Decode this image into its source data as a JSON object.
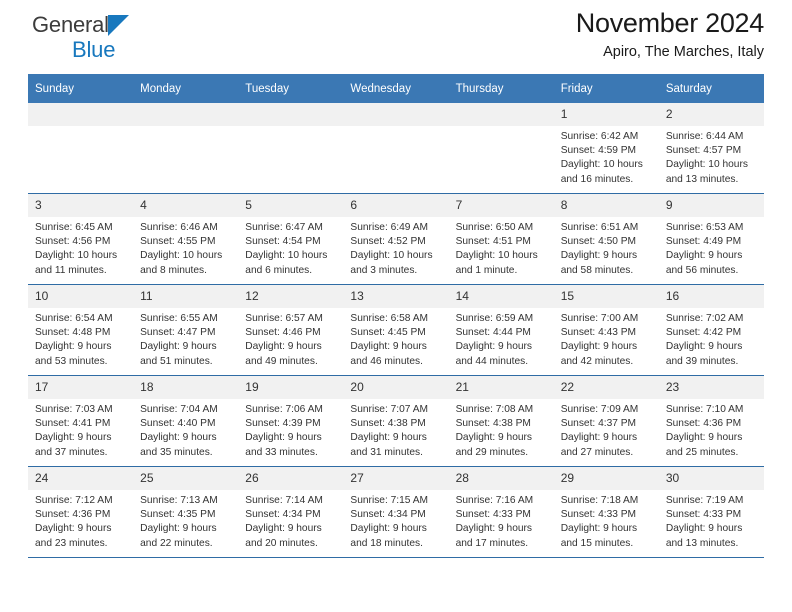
{
  "brand": {
    "word1": "General",
    "word2": "Blue",
    "triangle_color": "#1878be",
    "word1_color": "#3c3c3c",
    "word2_color": "#1878be"
  },
  "header": {
    "title": "November 2024",
    "subtitle": "Apiro, The Marches, Italy",
    "header_bg": "#3b78b4",
    "row_line_color": "#2f6ca5",
    "daynum_bg": "#f1f1f1"
  },
  "weekday_headers": [
    "Sunday",
    "Monday",
    "Tuesday",
    "Wednesday",
    "Thursday",
    "Friday",
    "Saturday"
  ],
  "weeks": [
    [
      {
        "day": "",
        "empty": true,
        "sunrise": "",
        "sunset": "",
        "daylight1": "",
        "daylight2": ""
      },
      {
        "day": "",
        "empty": true,
        "sunrise": "",
        "sunset": "",
        "daylight1": "",
        "daylight2": ""
      },
      {
        "day": "",
        "empty": true,
        "sunrise": "",
        "sunset": "",
        "daylight1": "",
        "daylight2": ""
      },
      {
        "day": "",
        "empty": true,
        "sunrise": "",
        "sunset": "",
        "daylight1": "",
        "daylight2": ""
      },
      {
        "day": "",
        "empty": true,
        "sunrise": "",
        "sunset": "",
        "daylight1": "",
        "daylight2": ""
      },
      {
        "day": "1",
        "sunrise": "Sunrise: 6:42 AM",
        "sunset": "Sunset: 4:59 PM",
        "daylight1": "Daylight: 10 hours",
        "daylight2": "and 16 minutes."
      },
      {
        "day": "2",
        "sunrise": "Sunrise: 6:44 AM",
        "sunset": "Sunset: 4:57 PM",
        "daylight1": "Daylight: 10 hours",
        "daylight2": "and 13 minutes."
      }
    ],
    [
      {
        "day": "3",
        "sunrise": "Sunrise: 6:45 AM",
        "sunset": "Sunset: 4:56 PM",
        "daylight1": "Daylight: 10 hours",
        "daylight2": "and 11 minutes."
      },
      {
        "day": "4",
        "sunrise": "Sunrise: 6:46 AM",
        "sunset": "Sunset: 4:55 PM",
        "daylight1": "Daylight: 10 hours",
        "daylight2": "and 8 minutes."
      },
      {
        "day": "5",
        "sunrise": "Sunrise: 6:47 AM",
        "sunset": "Sunset: 4:54 PM",
        "daylight1": "Daylight: 10 hours",
        "daylight2": "and 6 minutes."
      },
      {
        "day": "6",
        "sunrise": "Sunrise: 6:49 AM",
        "sunset": "Sunset: 4:52 PM",
        "daylight1": "Daylight: 10 hours",
        "daylight2": "and 3 minutes."
      },
      {
        "day": "7",
        "sunrise": "Sunrise: 6:50 AM",
        "sunset": "Sunset: 4:51 PM",
        "daylight1": "Daylight: 10 hours",
        "daylight2": "and 1 minute."
      },
      {
        "day": "8",
        "sunrise": "Sunrise: 6:51 AM",
        "sunset": "Sunset: 4:50 PM",
        "daylight1": "Daylight: 9 hours",
        "daylight2": "and 58 minutes."
      },
      {
        "day": "9",
        "sunrise": "Sunrise: 6:53 AM",
        "sunset": "Sunset: 4:49 PM",
        "daylight1": "Daylight: 9 hours",
        "daylight2": "and 56 minutes."
      }
    ],
    [
      {
        "day": "10",
        "sunrise": "Sunrise: 6:54 AM",
        "sunset": "Sunset: 4:48 PM",
        "daylight1": "Daylight: 9 hours",
        "daylight2": "and 53 minutes."
      },
      {
        "day": "11",
        "sunrise": "Sunrise: 6:55 AM",
        "sunset": "Sunset: 4:47 PM",
        "daylight1": "Daylight: 9 hours",
        "daylight2": "and 51 minutes."
      },
      {
        "day": "12",
        "sunrise": "Sunrise: 6:57 AM",
        "sunset": "Sunset: 4:46 PM",
        "daylight1": "Daylight: 9 hours",
        "daylight2": "and 49 minutes."
      },
      {
        "day": "13",
        "sunrise": "Sunrise: 6:58 AM",
        "sunset": "Sunset: 4:45 PM",
        "daylight1": "Daylight: 9 hours",
        "daylight2": "and 46 minutes."
      },
      {
        "day": "14",
        "sunrise": "Sunrise: 6:59 AM",
        "sunset": "Sunset: 4:44 PM",
        "daylight1": "Daylight: 9 hours",
        "daylight2": "and 44 minutes."
      },
      {
        "day": "15",
        "sunrise": "Sunrise: 7:00 AM",
        "sunset": "Sunset: 4:43 PM",
        "daylight1": "Daylight: 9 hours",
        "daylight2": "and 42 minutes."
      },
      {
        "day": "16",
        "sunrise": "Sunrise: 7:02 AM",
        "sunset": "Sunset: 4:42 PM",
        "daylight1": "Daylight: 9 hours",
        "daylight2": "and 39 minutes."
      }
    ],
    [
      {
        "day": "17",
        "sunrise": "Sunrise: 7:03 AM",
        "sunset": "Sunset: 4:41 PM",
        "daylight1": "Daylight: 9 hours",
        "daylight2": "and 37 minutes."
      },
      {
        "day": "18",
        "sunrise": "Sunrise: 7:04 AM",
        "sunset": "Sunset: 4:40 PM",
        "daylight1": "Daylight: 9 hours",
        "daylight2": "and 35 minutes."
      },
      {
        "day": "19",
        "sunrise": "Sunrise: 7:06 AM",
        "sunset": "Sunset: 4:39 PM",
        "daylight1": "Daylight: 9 hours",
        "daylight2": "and 33 minutes."
      },
      {
        "day": "20",
        "sunrise": "Sunrise: 7:07 AM",
        "sunset": "Sunset: 4:38 PM",
        "daylight1": "Daylight: 9 hours",
        "daylight2": "and 31 minutes."
      },
      {
        "day": "21",
        "sunrise": "Sunrise: 7:08 AM",
        "sunset": "Sunset: 4:38 PM",
        "daylight1": "Daylight: 9 hours",
        "daylight2": "and 29 minutes."
      },
      {
        "day": "22",
        "sunrise": "Sunrise: 7:09 AM",
        "sunset": "Sunset: 4:37 PM",
        "daylight1": "Daylight: 9 hours",
        "daylight2": "and 27 minutes."
      },
      {
        "day": "23",
        "sunrise": "Sunrise: 7:10 AM",
        "sunset": "Sunset: 4:36 PM",
        "daylight1": "Daylight: 9 hours",
        "daylight2": "and 25 minutes."
      }
    ],
    [
      {
        "day": "24",
        "sunrise": "Sunrise: 7:12 AM",
        "sunset": "Sunset: 4:36 PM",
        "daylight1": "Daylight: 9 hours",
        "daylight2": "and 23 minutes."
      },
      {
        "day": "25",
        "sunrise": "Sunrise: 7:13 AM",
        "sunset": "Sunset: 4:35 PM",
        "daylight1": "Daylight: 9 hours",
        "daylight2": "and 22 minutes."
      },
      {
        "day": "26",
        "sunrise": "Sunrise: 7:14 AM",
        "sunset": "Sunset: 4:34 PM",
        "daylight1": "Daylight: 9 hours",
        "daylight2": "and 20 minutes."
      },
      {
        "day": "27",
        "sunrise": "Sunrise: 7:15 AM",
        "sunset": "Sunset: 4:34 PM",
        "daylight1": "Daylight: 9 hours",
        "daylight2": "and 18 minutes."
      },
      {
        "day": "28",
        "sunrise": "Sunrise: 7:16 AM",
        "sunset": "Sunset: 4:33 PM",
        "daylight1": "Daylight: 9 hours",
        "daylight2": "and 17 minutes."
      },
      {
        "day": "29",
        "sunrise": "Sunrise: 7:18 AM",
        "sunset": "Sunset: 4:33 PM",
        "daylight1": "Daylight: 9 hours",
        "daylight2": "and 15 minutes."
      },
      {
        "day": "30",
        "sunrise": "Sunrise: 7:19 AM",
        "sunset": "Sunset: 4:33 PM",
        "daylight1": "Daylight: 9 hours",
        "daylight2": "and 13 minutes."
      }
    ]
  ]
}
